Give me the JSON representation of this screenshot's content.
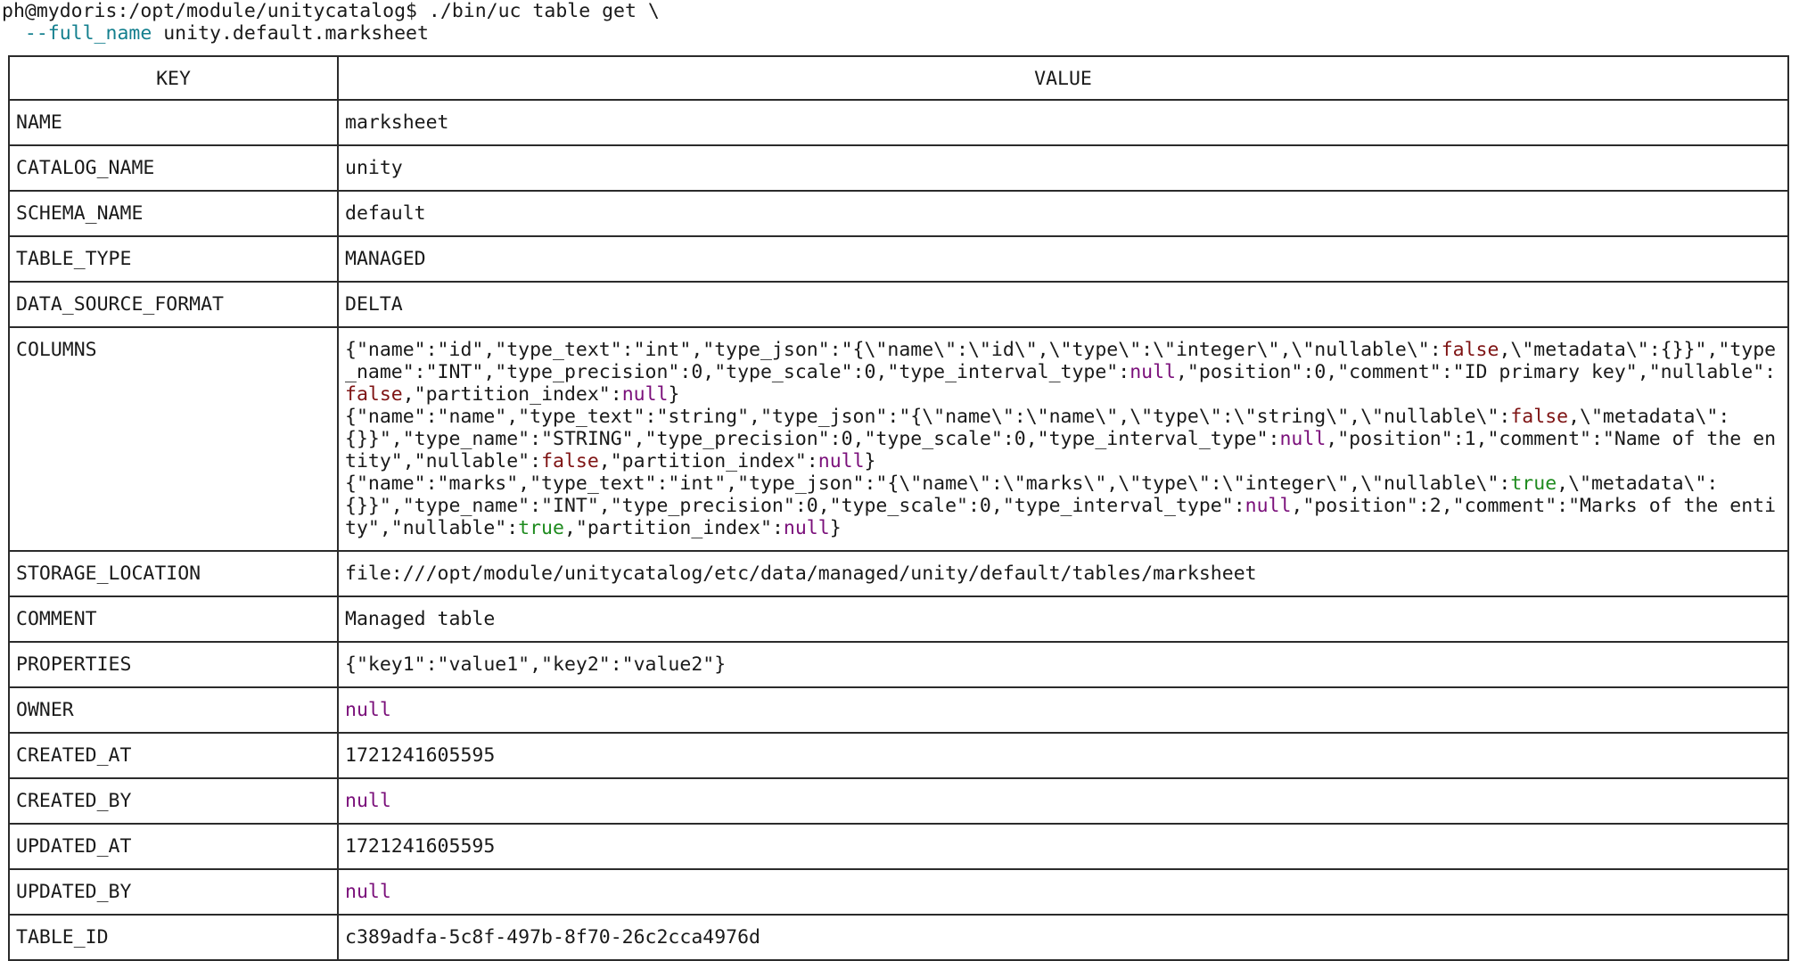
{
  "terminal": {
    "prompt_line": "ph@mydoris:/opt/module/unitycatalog$ ./bin/uc table get \\",
    "arg_indent": "  ",
    "arg_flag": "--full_name",
    "arg_value": " unity.default.marksheet"
  },
  "table": {
    "headers": {
      "key": "KEY",
      "value": "VALUE"
    },
    "rows": [
      {
        "key": "NAME",
        "value": "marksheet"
      },
      {
        "key": "CATALOG_NAME",
        "value": "unity"
      },
      {
        "key": "SCHEMA_NAME",
        "value": "default"
      },
      {
        "key": "TABLE_TYPE",
        "value": "MANAGED"
      },
      {
        "key": "DATA_SOURCE_FORMAT",
        "value": "DELTA"
      },
      {
        "key": "COLUMNS",
        "value": ""
      },
      {
        "key": "STORAGE_LOCATION",
        "value": "file:///opt/module/unitycatalog/etc/data/managed/unity/default/tables/marksheet"
      },
      {
        "key": "COMMENT",
        "value": "Managed table"
      },
      {
        "key": "PROPERTIES",
        "value": "{\"key1\":\"value1\",\"key2\":\"value2\"}"
      },
      {
        "key": "OWNER",
        "value": "null"
      },
      {
        "key": "CREATED_AT",
        "value": "1721241605595"
      },
      {
        "key": "CREATED_BY",
        "value": "null"
      },
      {
        "key": "UPDATED_AT",
        "value": "1721241605595"
      },
      {
        "key": "UPDATED_BY",
        "value": "null"
      },
      {
        "key": "TABLE_ID",
        "value": "c389adfa-5c8f-497b-8f70-26c2cca4976d"
      }
    ],
    "columns_lines": [
      [
        [
          "{\"name\":\"id\",\"type_text\":\"int\",\"type_json\":\"{\\\"name\\\":\\\"id\\\",\\\"type\\\":\\\"integer\\\",\\\"nullable\\\":",
          "t"
        ],
        [
          "false",
          "false"
        ],
        [
          ",\\\"metadata\\\":{}}\",\"type_name\":\"INT\",\"type_precision\":0,\"type_scale\":0,\"type_interval_type\":",
          "t"
        ],
        [
          "null",
          "null"
        ],
        [
          ",\"position\":0,\"comment\":\"ID primary key\",\"nullable\":",
          "t"
        ],
        [
          "false",
          "false"
        ],
        [
          ",\"partition_index\":",
          "t"
        ],
        [
          "null",
          "null"
        ],
        [
          "}",
          "t"
        ]
      ],
      [
        [
          "{\"name\":\"name\",\"type_text\":\"string\",\"type_json\":\"{\\\"name\\\":\\\"name\\\",\\\"type\\\":\\\"string\\\",\\\"nullable\\\":",
          "t"
        ],
        [
          "false",
          "false"
        ],
        [
          ",\\\"metadata\\\":{}}\",\"type_name\":\"STRING\",\"type_precision\":0,\"type_scale\":0,\"type_interval_type\":",
          "t"
        ],
        [
          "null",
          "null"
        ],
        [
          ",\"position\":1,\"comment\":\"Name of the entity\",\"nullable\":",
          "t"
        ],
        [
          "false",
          "false"
        ],
        [
          ",\"partition_index\":",
          "t"
        ],
        [
          "null",
          "null"
        ],
        [
          "}",
          "t"
        ]
      ],
      [
        [
          "{\"name\":\"marks\",\"type_text\":\"int\",\"type_json\":\"{\\\"name\\\":\\\"marks\\\",\\\"type\\\":\\\"integer\\\",\\\"nullable\\\":",
          "t"
        ],
        [
          "true",
          "true"
        ],
        [
          ",\\\"metadata\\\":{}}\",\"type_name\":\"INT\",\"type_precision\":0,\"type_scale\":0,\"type_interval_type\":",
          "t"
        ],
        [
          "null",
          "null"
        ],
        [
          ",\"position\":2,\"comment\":\"Marks of the entity\",\"nullable\":",
          "t"
        ],
        [
          "true",
          "true"
        ],
        [
          ",\"partition_index\":",
          "t"
        ],
        [
          "null",
          "null"
        ],
        [
          "}",
          "t"
        ]
      ]
    ]
  },
  "colors": {
    "null": "#7a0f7a",
    "false": "#7e1313",
    "true": "#1e8b1e",
    "flag": "#137f8e"
  }
}
